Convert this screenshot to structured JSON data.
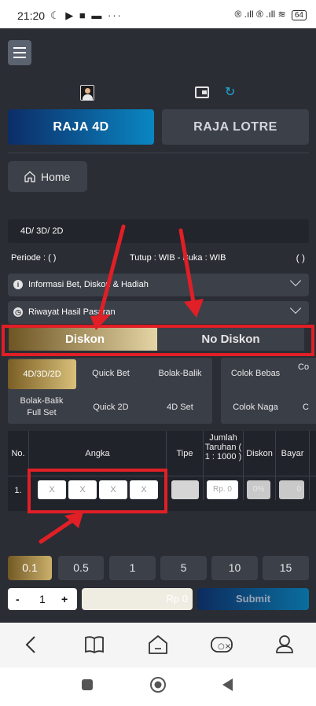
{
  "status_bar": {
    "time": "21:20",
    "left_icons": "☾ ▶ ■ ▬ ···",
    "right_icons": "® .ıll ® .ıll ≋",
    "battery": "64"
  },
  "tabs": [
    {
      "label": "RAJA 4D",
      "active": true
    },
    {
      "label": "RAJA LOTRE",
      "active": false
    }
  ],
  "home_label": "Home",
  "game_type": "4D/ 3D/ 2D",
  "periode": "Periode : ( )",
  "tutup": "Tutup : WIB - Buka : WIB",
  "paren": "( )",
  "accordions": [
    {
      "label": "Informasi Bet, Diskon & Hadiah",
      "icon": "info-icon"
    },
    {
      "label": "Riwayat Hasil Pasaran",
      "icon": "history-icon"
    }
  ],
  "discount_tabs": [
    "Diskon",
    "No Diskon"
  ],
  "bet_types": {
    "panel1": [
      "4D/3D/2D",
      "Quick Bet",
      "Bolak-Balik",
      "Bolak-Balik Full Set",
      "Quick 2D",
      "4D Set"
    ],
    "panel2": [
      "Colok Bebas",
      "Co",
      "Colok Naga",
      "C"
    ]
  },
  "table": {
    "headers": [
      "No.",
      "Angka",
      "Tipe",
      "Jumlah Taruhan ( 1 : 1000 )",
      "Diskon",
      "Bayar"
    ],
    "row_no": "1.",
    "digit_placeholder": "X",
    "amount_placeholder": "Rp. 0",
    "diskon_value": "0%",
    "bayar_value": "0"
  },
  "amounts": [
    "0.1",
    "0.5",
    "1",
    "5",
    "10",
    "15"
  ],
  "quantity": {
    "minus": "-",
    "value": "1",
    "plus": "+"
  },
  "rp_total": "Rp 0",
  "submit_label": "Submit"
}
